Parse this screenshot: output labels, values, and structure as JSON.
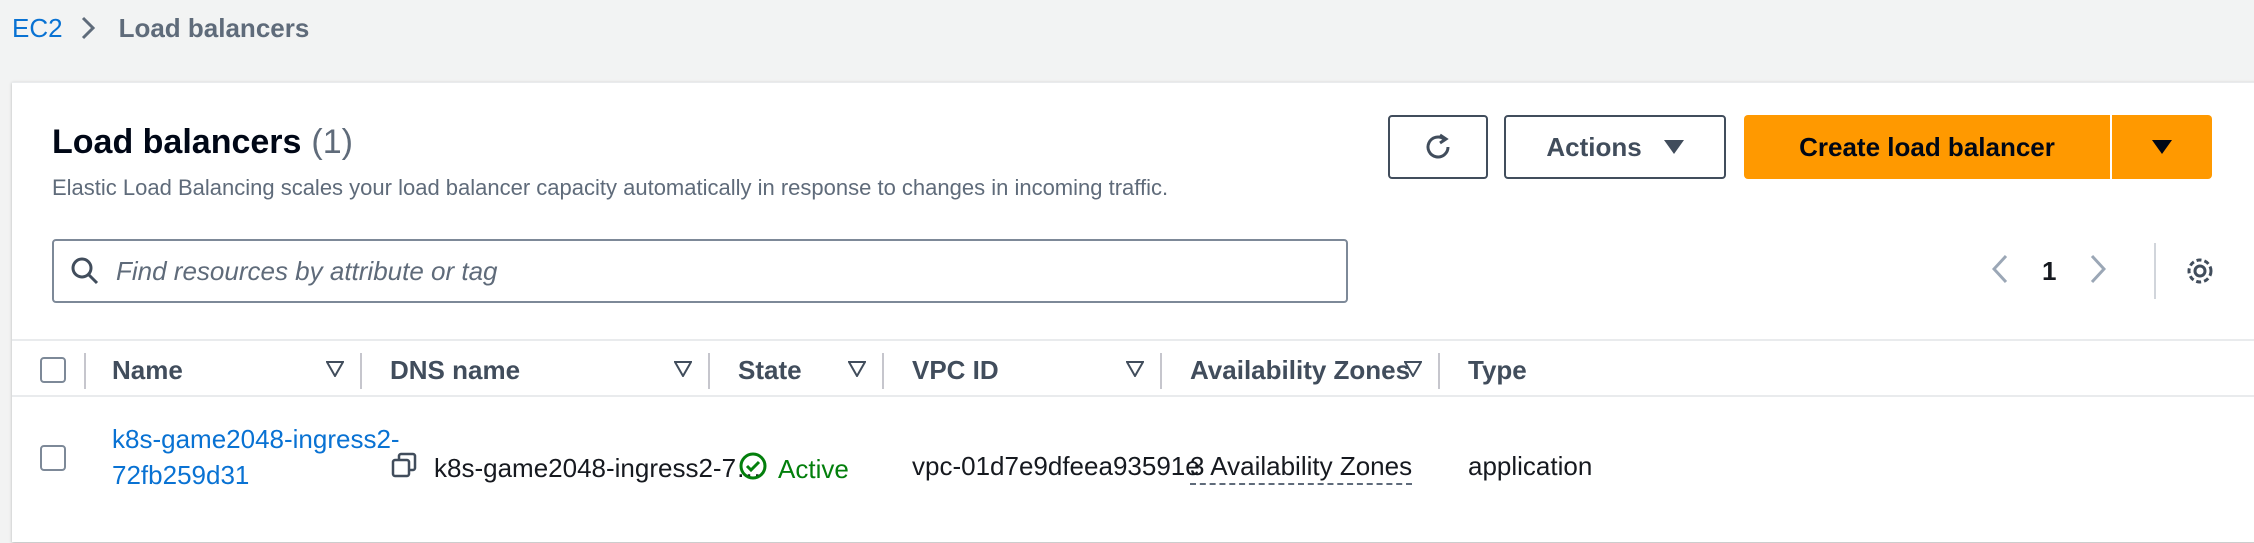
{
  "breadcrumb": {
    "root": "EC2",
    "current": "Load balancers"
  },
  "header": {
    "title": "Load balancers",
    "count": "(1)",
    "description": "Elastic Load Balancing scales your load balancer capacity automatically in response to changes in incoming traffic."
  },
  "buttons": {
    "actions_label": "Actions",
    "create_label": "Create load balancer"
  },
  "search": {
    "placeholder": "Find resources by attribute or tag",
    "value": ""
  },
  "pagination": {
    "current_page": "1"
  },
  "table": {
    "columns": [
      "Name",
      "DNS name",
      "State",
      "VPC ID",
      "Availability Zones",
      "Type"
    ],
    "rows": [
      {
        "name_line1": "k8s-game2048-ingress2-",
        "name_line2": "72fb259d31",
        "dns_name": "k8s-game2048-ingress2-7…",
        "state": "Active",
        "vpc_id": "vpc-01d7e9dfeea93591e",
        "availability_zones": "3 Availability Zones",
        "type": "application"
      }
    ]
  },
  "colors": {
    "link": "#0972d3",
    "primary": "#ff9900",
    "success": "#037f0c"
  },
  "icons": [
    "chevron-right-icon",
    "refresh-icon",
    "caret-down-icon",
    "search-icon",
    "chevron-left-icon",
    "settings-gear-icon",
    "sort-icon",
    "copy-icon",
    "status-success-icon"
  ]
}
